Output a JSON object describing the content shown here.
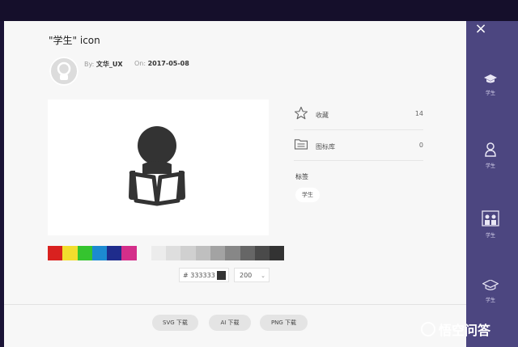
{
  "modal": {
    "title": "\"学生\" icon",
    "close_icon": "×",
    "author_label": "By:",
    "author": "文华_UX",
    "date_label": "On:",
    "date": "2017-05-08"
  },
  "palette": {
    "colors": [
      "#d9211f",
      "#f2dd2d",
      "#35c42f",
      "#1c8ad1",
      "#1f2c8c",
      "#d42e8a"
    ],
    "grays": [
      "#ececec",
      "#dedede",
      "#d0d0d0",
      "#bfbfbf",
      "#a3a3a3",
      "#878787",
      "#666666",
      "#4a4a4a",
      "#333333"
    ]
  },
  "controls": {
    "hex_value": "# 333333",
    "hex_color": "#333333",
    "size_value": "200",
    "size_caret": "⌄"
  },
  "stats": [
    {
      "icon": "star-icon",
      "label": "收藏",
      "count": "14"
    },
    {
      "icon": "library-icon",
      "label": "图标库",
      "count": "0"
    }
  ],
  "tags": {
    "heading": "标签",
    "items": [
      "学生"
    ]
  },
  "downloads": [
    "SVG 下载",
    "AI 下载",
    "PNG 下载"
  ],
  "sidebar": {
    "items": [
      {
        "icon": "graduation-cap-icon",
        "label": "学生"
      },
      {
        "icon": "person-icon",
        "label": "学生"
      },
      {
        "icon": "students-group-icon",
        "label": "学生"
      },
      {
        "icon": "graduation-cap-icon",
        "label": "学生"
      }
    ]
  },
  "watermark": {
    "text": "悟空问答"
  }
}
